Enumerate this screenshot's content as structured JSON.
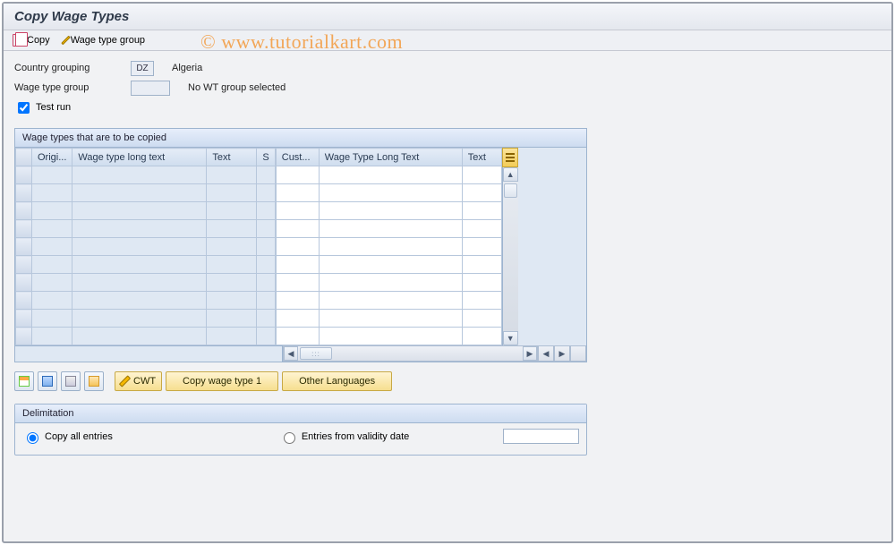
{
  "title": "Copy Wage Types",
  "watermark": "©   www.tutorialkart.com",
  "toolbar": {
    "copy_label": "Copy",
    "wtg_label": "Wage type group"
  },
  "form": {
    "country_grouping_label": "Country grouping",
    "country_code": "DZ",
    "country_name": "Algeria",
    "wage_type_group_label": "Wage type group",
    "wage_type_group_value": "",
    "wage_type_group_text": "No WT group selected",
    "test_run_label": "Test run",
    "test_run_checked": true
  },
  "grid": {
    "panel_title": "Wage types that are to be copied",
    "columns": {
      "origi": "Origi...",
      "wtlt1": "Wage type long text",
      "text1": "Text",
      "s": "S",
      "cust": "Cust...",
      "wtlt2": "Wage Type Long Text",
      "text2": "Text"
    },
    "rows": [
      {},
      {},
      {},
      {},
      {},
      {},
      {},
      {},
      {},
      {}
    ]
  },
  "buttons": {
    "cwt_label": "CWT",
    "copy_wt1_label": "Copy wage type 1",
    "other_lang_label": "Other Languages"
  },
  "delimitation": {
    "group_title": "Delimitation",
    "copy_all_label": "Copy all entries",
    "entries_from_label": "Entries from validity date",
    "selected": "copy_all",
    "date_value": ""
  }
}
